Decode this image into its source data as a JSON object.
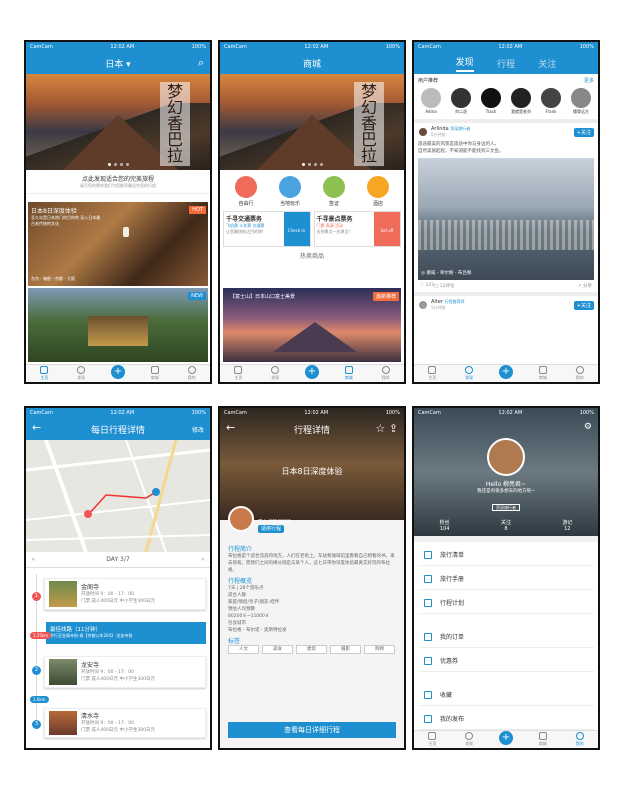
{
  "status": {
    "carrier": "CamCam",
    "time": "12:02 AM",
    "battery": "100%"
  },
  "tabbar": {
    "home": "主页",
    "discover": "发现",
    "plus": "+",
    "mall": "商城",
    "mine": "我的"
  },
  "s1": {
    "title": "日本",
    "promo": "点此发现适合您的完美旅程",
    "sub": "填写您的需求我们为您推荐最适合您的行程",
    "card1_tag": "HOT",
    "card1_title": "日本8日深度体验",
    "card1_desc": "亚久岛是日本热门的目的地 深入日本最古老传统的文化",
    "card1_route": "东京 - 箱根 - 京都 - 大阪",
    "card2_tag": "NEW",
    "hero_text": "梦幻香巴拉"
  },
  "s2": {
    "title": "商城",
    "hero_text": "梦幻香巴拉",
    "cats": [
      "自由行",
      "当地玩乐",
      "签证",
      "酒店"
    ],
    "pr1_title": "千寻交通票务",
    "pr1_tags": [
      "飞机票",
      "火车票",
      "交通票"
    ],
    "pr1_desc": "让您最快抵达目的地!",
    "pr1_btn": "Check-in",
    "pr2_title": "千寻景点票务",
    "pr2_tags": [
      "门票",
      "表演",
      "活动"
    ],
    "pr2_desc": "去到景点一应俱全!",
    "pr2_btn": "Set off",
    "hot": "热卖商品",
    "hot_tag": "富士山",
    "hot_title": "【富士山】日本山口富士美景",
    "hot_badge": "最新推荐"
  },
  "s3": {
    "tabs": [
      "发现",
      "行程",
      "关注"
    ],
    "rec": "用户推荐",
    "more": "更多",
    "users": [
      "Adina",
      "刘二虎",
      "Track",
      "我就是老刘",
      "Frank",
      "懂骨远方"
    ],
    "post1_user": "Arlinda",
    "post1_tag": "资深旅行者",
    "post1_time": "5分钟前",
    "post1_text": "旅途最美的风景是旅途中你与身边的人。",
    "post1_text2": "自然美丽起程，不知道能不能找到三文鱼。",
    "follow": "+关注",
    "post1_loc": "挪威 - 卑尔根 - 布吕根",
    "likes": "123",
    "comments": "12评论",
    "share": "分享",
    "post2_user": "Alter",
    "post2_tag": "行程推荐师",
    "post2_time": "5分钟前"
  },
  "s4": {
    "title": "每日行程详情",
    "edit": "修改",
    "day": "DAY 3/7",
    "stops": [
      {
        "name": "金阁寺",
        "hours": "开放时间 9：00 - 17：00",
        "fee": "门票 成人400日元 中小学生300日元"
      },
      {
        "name": "龙安寺",
        "hours": "开放时间 9：00 - 17：00",
        "fee": "门票 成人400日元 中小学生300日元"
      },
      {
        "name": "清水寺",
        "hours": "开放时间 9：00 - 17：00",
        "fee": "门票 成人400日元 中小学生300日元"
      }
    ],
    "route_title": "最佳线路（11分钟）",
    "route_desc": "步行至金阁寺前-乘【京都公车204】-龙安寺前",
    "d1": "1.25km",
    "d2": "2.6km"
  },
  "s5": {
    "title": "行程详情",
    "hero_title": "日本8日深度体验",
    "guide": "李山 行程规划师",
    "guide_btn": "适用行程",
    "intro_h": "行程简介",
    "intro": "布拉格是个适合流浪的地方，人们在老街上，车站和咖啡馆里看看自己想看的书，来去匆匆。而我们之间的缘分则是与某个人，这七日带你深度体验最真实好玩的布拉格。",
    "overview_h": "行程概览",
    "overview": [
      "7天 | 28个游乐点",
      "适合人群",
      "家庭/情侣/亲子/朋友-结伴",
      "预估人均预算",
      "80200￥~11000￥",
      "包含城市",
      "布拉格 - 布尔诺 - 奥斯特拉发"
    ],
    "tags_h": "标签",
    "tags": [
      "人文",
      "美食",
      "建筑",
      "摄影",
      "购物"
    ],
    "cta": "查看每日详细行程"
  },
  "s6": {
    "hello": "Hello 柳亮君~",
    "bio": "我还是有很多想去的地方呢~",
    "badge": "资深旅行者",
    "stats": [
      {
        "label": "粉丝",
        "value": "104"
      },
      {
        "label": "关注",
        "value": "8"
      },
      {
        "label": "游记",
        "value": "12"
      }
    ],
    "menu": [
      "旅行清单",
      "旅行手册",
      "行程计划",
      "我的订单",
      "优惠券",
      "收藏",
      "我的发布"
    ]
  }
}
